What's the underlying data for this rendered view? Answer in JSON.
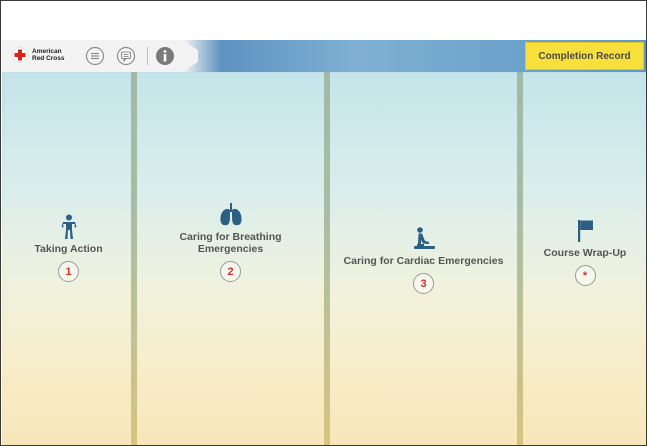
{
  "toolbar": {
    "logo_line1": "American",
    "logo_line2": "Red Cross",
    "completion_label": "Completion Record",
    "icons": [
      "red-cross-logo",
      "menu-icon",
      "chat-icon",
      "info-icon"
    ]
  },
  "modules": [
    {
      "label": "Taking Action",
      "number": "1",
      "icon": "person-standing-icon"
    },
    {
      "label": "Caring for Breathing Emergencies",
      "number": "2",
      "icon": "lungs-icon"
    },
    {
      "label": "Caring for Cardiac Emergencies",
      "number": "3",
      "icon": "cpr-icon"
    },
    {
      "label": "Course Wrap-Up",
      "number": "*",
      "icon": "flag-icon"
    }
  ],
  "colors": {
    "accent_yellow": "#f7df3c",
    "number_red": "#d12f2a",
    "toolbar_blue": "#6ea3cb"
  }
}
